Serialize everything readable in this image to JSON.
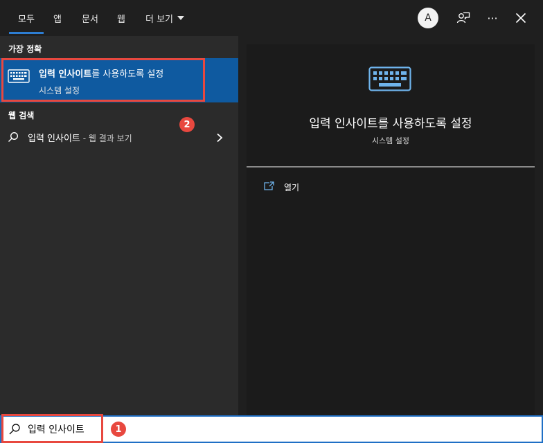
{
  "tabs": [
    {
      "label": "모두"
    },
    {
      "label": "앱"
    },
    {
      "label": "문서"
    },
    {
      "label": "웹"
    },
    {
      "label": "더 보기"
    }
  ],
  "header": {
    "avatar_letter": "A",
    "more_glyph": "···",
    "close_glyph": "✕"
  },
  "left": {
    "best_match_label": "가장 정확",
    "best_match": {
      "title_bold": "입력 인사이트",
      "title_rest": "를 사용하도록 설정",
      "subtitle": "시스템 설정"
    },
    "web_search_label": "웹 검색",
    "web_result": {
      "query": "입력 인사이트",
      "suffix": " - 웹 결과 보기"
    }
  },
  "right": {
    "title": "입력 인사이트를 사용하도록 설정",
    "subtitle": "시스템 설정",
    "actions": [
      {
        "label": "열기"
      }
    ]
  },
  "search": {
    "value": "입력 인사이트"
  },
  "badges": {
    "one": "1",
    "two": "2"
  },
  "colors": {
    "accent": "#0f5aa0",
    "highlight": "#e8483f",
    "background": "#1f1f1f"
  }
}
